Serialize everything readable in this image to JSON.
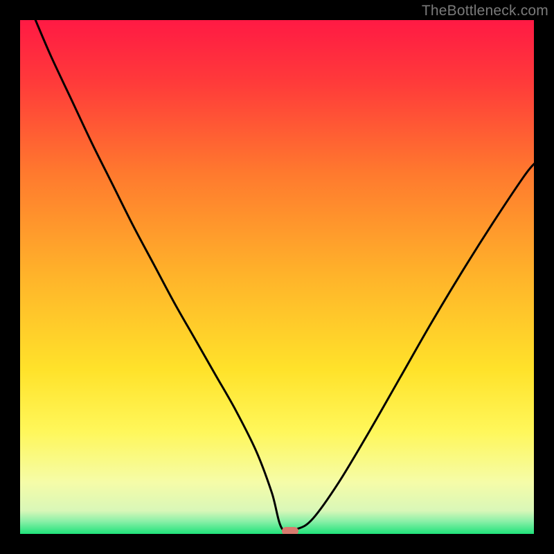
{
  "watermark": "TheBottleneck.com",
  "marker": {
    "cx_pct": 52.5,
    "cy_pct": 99.5
  },
  "chart_data": {
    "type": "line",
    "title": "",
    "xlabel": "",
    "ylabel": "",
    "xlim": [
      0,
      100
    ],
    "ylim": [
      0,
      100
    ],
    "grid": false,
    "legend": false,
    "gradient_stops": [
      {
        "offset": 0.0,
        "color": "#ff1a44"
      },
      {
        "offset": 0.12,
        "color": "#ff3a3a"
      },
      {
        "offset": 0.3,
        "color": "#ff7a2e"
      },
      {
        "offset": 0.5,
        "color": "#ffb42a"
      },
      {
        "offset": 0.68,
        "color": "#ffe22a"
      },
      {
        "offset": 0.8,
        "color": "#fff75a"
      },
      {
        "offset": 0.9,
        "color": "#f5fca8"
      },
      {
        "offset": 0.955,
        "color": "#d9f7b8"
      },
      {
        "offset": 0.975,
        "color": "#8cf0a8"
      },
      {
        "offset": 1.0,
        "color": "#1fe27a"
      }
    ],
    "series": [
      {
        "name": "bottleneck-curve",
        "x": [
          3,
          6,
          10,
          14,
          18,
          22,
          26,
          30,
          34,
          38,
          42,
          46,
          49,
          51,
          54,
          57,
          62,
          68,
          74,
          80,
          86,
          92,
          98,
          100
        ],
        "y": [
          100,
          93,
          84.5,
          76,
          68,
          60,
          52.5,
          45,
          38,
          31,
          24,
          16,
          8,
          1,
          1,
          3,
          10,
          20,
          30.5,
          41,
          51,
          60.5,
          69.5,
          72
        ]
      }
    ],
    "marker": {
      "x": 52.5,
      "y": 0.5,
      "color": "#d87a6e"
    }
  }
}
